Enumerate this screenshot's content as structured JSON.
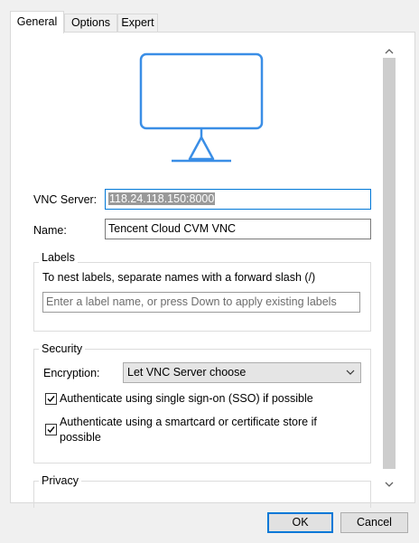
{
  "tabs": [
    "General",
    "Options",
    "Expert"
  ],
  "general": {
    "vnc_server_label": "VNC Server:",
    "vnc_server_value": "118.24.118.150:8000",
    "name_label": "Name:",
    "name_value": "Tencent Cloud CVM VNC",
    "labels_group": "Labels",
    "labels_hint": "To nest labels, separate names with a forward slash (/)",
    "labels_placeholder": "Enter a label name, or press Down to apply existing labels",
    "security_group": "Security",
    "encryption_label": "Encryption:",
    "encryption_value": "Let VNC Server choose",
    "sso_label": "Authenticate using single sign-on (SSO) if possible",
    "sso_checked": true,
    "smartcard_label_line1": "Authenticate using a smartcard or certificate store if",
    "smartcard_label_line2": "possible",
    "smartcard_checked": true,
    "privacy_group": "Privacy"
  },
  "buttons": {
    "ok": "OK",
    "cancel": "Cancel"
  },
  "icons": {
    "monitor": "monitor-icon",
    "dropdown": "chevron-down-icon",
    "scroll_up": "scroll-up-arrow",
    "scroll_down": "scroll-down-arrow"
  },
  "colors": {
    "accent": "#0078d7",
    "monitor": "#3a8ee6",
    "selection": "#999999"
  }
}
